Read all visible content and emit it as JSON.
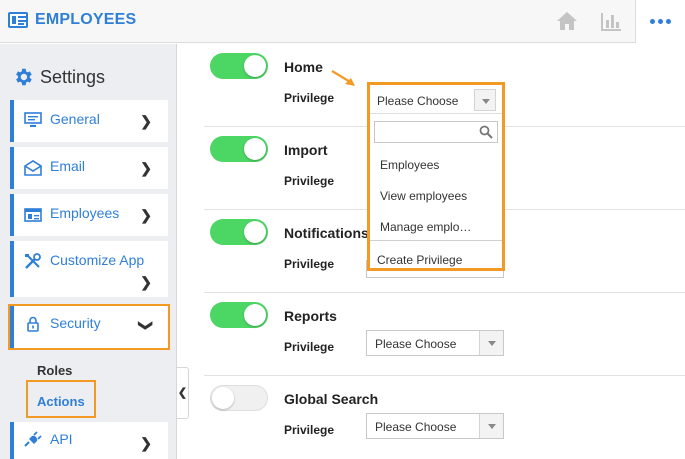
{
  "header": {
    "app_title": "EMPLOYEES",
    "icons": [
      "home-icon",
      "chart-icon",
      "more-icon"
    ],
    "accent_color": "#2f7fd8"
  },
  "sidebar": {
    "title": "Settings",
    "items": [
      {
        "label": "General",
        "icon": "monitor-icon"
      },
      {
        "label": "Email",
        "icon": "envelope-icon"
      },
      {
        "label": "Employees",
        "icon": "id-card-icon"
      },
      {
        "label": "Customize App",
        "icon": "tools-icon"
      },
      {
        "label": "Security",
        "icon": "lock-icon",
        "expanded": true
      },
      {
        "label": "API",
        "icon": "plug-icon"
      }
    ],
    "sub_items": [
      "Roles",
      "Actions"
    ],
    "active_sub_item": "Actions",
    "highlight_color": "#f29a24"
  },
  "main": {
    "privilege_label": "Privilege",
    "rows": [
      {
        "title": "Home",
        "enabled": true,
        "privilege": "Please Choose"
      },
      {
        "title": "Import",
        "enabled": true,
        "privilege": ""
      },
      {
        "title": "Notifications",
        "enabled": true,
        "privilege": ""
      },
      {
        "title": "Reports",
        "enabled": true,
        "privilege": "Please Choose"
      },
      {
        "title": "Global Search",
        "enabled": false,
        "privilege": "Please Choose"
      }
    ],
    "toggle_on_color": "#4cd664"
  },
  "dropdown": {
    "selected": "Please Choose",
    "search_placeholder": "",
    "options": [
      "Employees",
      "View employees",
      "Manage emplo…"
    ],
    "footer_option": "Create Privilege"
  }
}
